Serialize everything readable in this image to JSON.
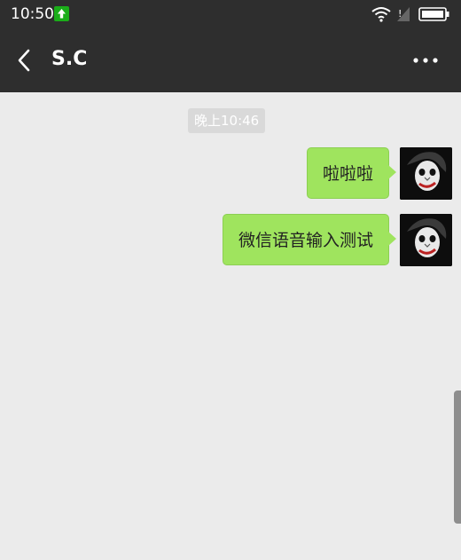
{
  "status_bar": {
    "time": "10:50",
    "upload_icon": "upload-arrow-icon",
    "wifi_icon": "wifi-icon",
    "signal_icon": "no-signal-icon",
    "battery_icon": "battery-icon",
    "background": "#2e2e2e"
  },
  "header": {
    "title": "S.C",
    "back_icon": "chevron-left-icon",
    "more_icon": "more-dots-icon"
  },
  "chat": {
    "background": "#ebebeb",
    "timestamp": "晚上10:46",
    "messages": [
      {
        "text": "啦啦啦",
        "sender": "self"
      },
      {
        "text": "微信语音输入测试",
        "sender": "self"
      }
    ],
    "bubble_color": "#9fe45e"
  }
}
